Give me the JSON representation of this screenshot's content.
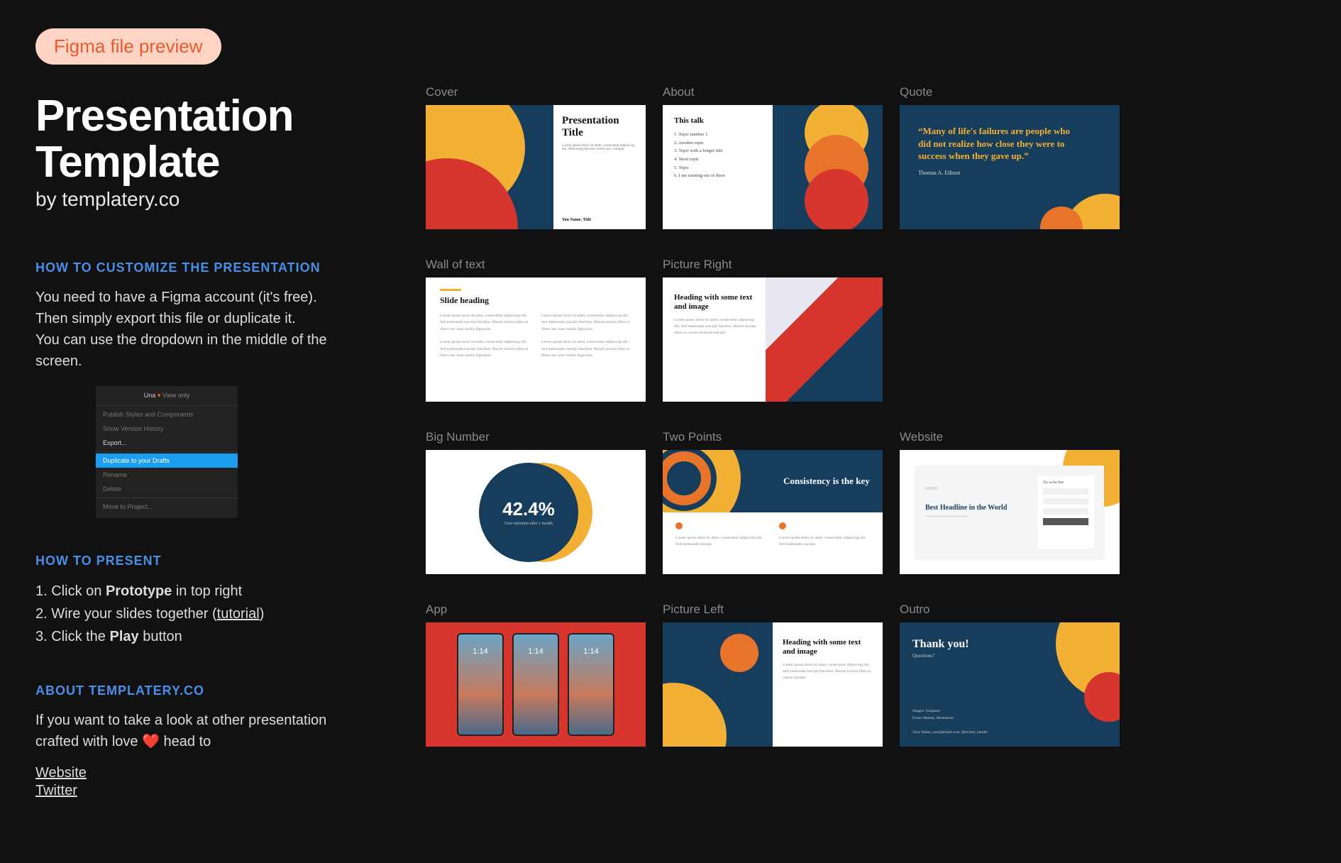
{
  "badge": "Figma file preview",
  "title": "Presentation Template",
  "byline": "by templatery.co",
  "sections": {
    "customize": {
      "label": "HOW TO CUSTOMIZE THE PRESENTATION",
      "p1": "You need to have a Figma account (it's free).",
      "p2": "Then simply export this file or duplicate it.",
      "p3": "You can use the dropdown in the middle of the screen.",
      "menu": {
        "title": "Una",
        "mode": "View only",
        "items": [
          "Publish Styles and Components",
          "Show Version History",
          "Export...",
          "Duplicate to your Drafts",
          "Rename",
          "Delete",
          "Move to Project..."
        ]
      }
    },
    "present": {
      "label": "HOW TO PRESENT",
      "i1_pre": "1. Click on ",
      "i1_b": "Prototype",
      "i1_post": " in top right",
      "i2_pre": "2. Wire your slides together (",
      "i2_link": "tutorial",
      "i2_post": ")",
      "i3_pre": "3. Click the ",
      "i3_b": "Play",
      "i3_post": " button"
    },
    "aboutSite": {
      "label": "ABOUT TEMPLATERY.CO",
      "p": "If you want to take a look at other presentation crafted with love ❤️ head to",
      "links": [
        "Website",
        "Twitter"
      ]
    }
  },
  "slides": {
    "cover": {
      "label": "Cover",
      "title": "Presentation Title",
      "sub": "Lorem ipsum dolor sit amet, consectetur adipiscing elit. Maecenas placerat viverra nec volutpat.",
      "author": "You Name, Title"
    },
    "about": {
      "label": "About",
      "title": "This talk",
      "items": [
        "1. Topic number 1",
        "2. Another topic",
        "3. Topic with a longer title",
        "4. Short topic",
        "5. Topic",
        "6. I am running out of these"
      ]
    },
    "quote": {
      "label": "Quote",
      "text": "“Many of life's failures are people who did not realize how close they were to success when they gave up.”",
      "author": "Thomas A. Edison"
    },
    "wot": {
      "label": "Wall of text",
      "heading": "Slide heading",
      "lorem": "Lorem ipsum dolor sit amet, consectetur adipiscing elit. Sed malesuada suscipit faucibus. Mauris lacinia nibus ut libero nec nunc mollis dignissim."
    },
    "pr": {
      "label": "Picture Right",
      "heading": "Heading with some text and image",
      "lorem": "Lorem ipsum dolor sit amet, consectetur adipiscing elit. Sed malesuada suscipit faucibus. Mauris lacinia nibus ac cursus euismod suscipit."
    },
    "bn": {
      "label": "Big Number",
      "value": "42.4%",
      "caption": "User retention after 1 month"
    },
    "tp": {
      "label": "Two Points",
      "heading": "Consistency is the key",
      "lorem": "Lorem ipsum dolor sit amet, consectetur adipiscing elit. Sed malesuada suscipit."
    },
    "ws": {
      "label": "Website",
      "logo": "LOGO",
      "headline": "Best Headline in the World",
      "form_title": "Try us for free"
    },
    "app": {
      "label": "App",
      "time": "1:14"
    },
    "pl": {
      "label": "Picture Left",
      "heading": "Heading with some text and image",
      "lorem": "Lorem ipsum dolor sit amet, consectetur adipiscing elit. Sed malesuada suscipit faucibus. Mauris lacinia nibus ac cursus suscipit."
    },
    "ot": {
      "label": "Outro",
      "heading": "Thank you!",
      "sub": "Questions?",
      "meta1": "Images: Unsplash",
      "meta2": "Fonts: Mulani, Montserrat",
      "meta3": "Your Name, your@email.com, @twitter_handle"
    }
  }
}
